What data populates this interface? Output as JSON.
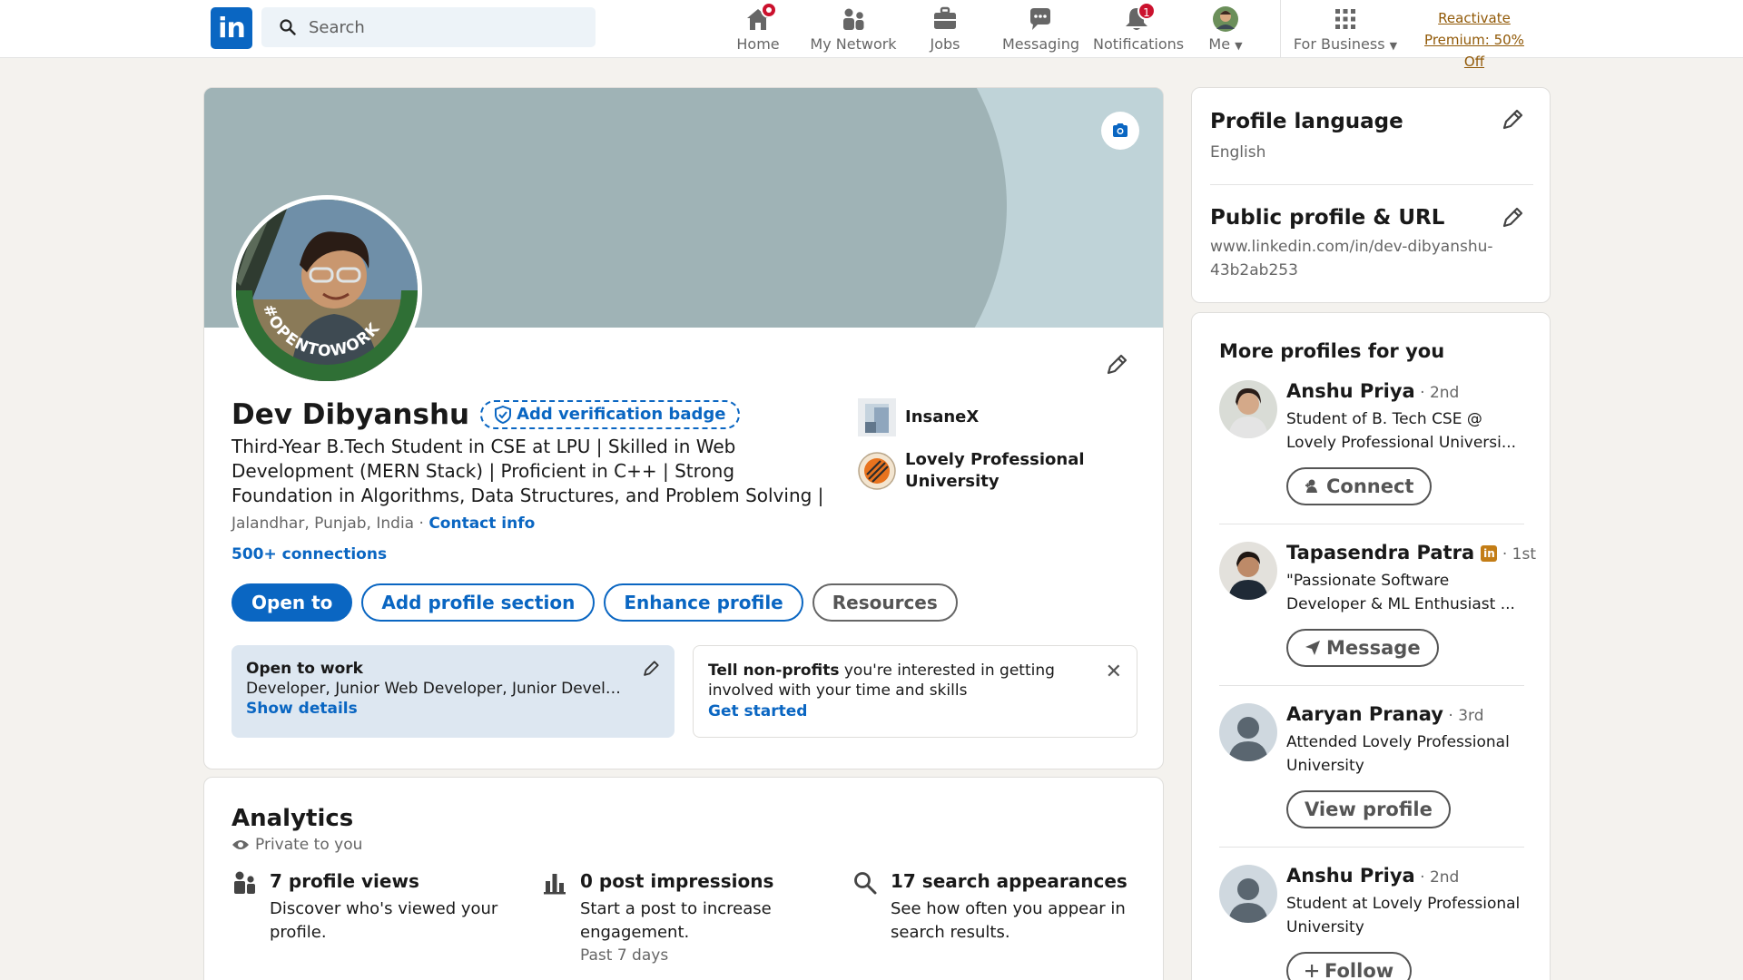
{
  "nav": {
    "logo_text": "in",
    "search_placeholder": "Search",
    "items": [
      {
        "label": "Home",
        "icon": "home-icon",
        "badge": "dot"
      },
      {
        "label": "My Network",
        "icon": "network-icon"
      },
      {
        "label": "Jobs",
        "icon": "briefcase-icon"
      },
      {
        "label": "Messaging",
        "icon": "messaging-icon"
      },
      {
        "label": "Notifications",
        "icon": "bell-icon",
        "badge": "1"
      },
      {
        "label": "Me",
        "icon": "avatar-icon"
      },
      {
        "label": "For Business",
        "icon": "grid-icon"
      }
    ],
    "premium_line1": "Reactivate",
    "premium_line2": "Premium: 50% Off"
  },
  "profile": {
    "name": "Dev Dibyanshu",
    "verification_label": "Add verification badge",
    "avatar_frame_text": "#OPENTOWORK",
    "headline": "Third-Year B.Tech Student in CSE at LPU | Skilled in Web Development (MERN Stack) | Proficient in C++ | Strong Foundation in Algorithms, Data Structures, and Problem Solving |",
    "location": "Jalandhar, Punjab, India",
    "location_sep": " · ",
    "contact_label": "Contact info",
    "connections": "500+ connections",
    "experience": [
      {
        "name": "InsaneX"
      },
      {
        "name": "Lovely Professional University"
      }
    ],
    "actions": {
      "open_to": "Open to",
      "add_section": "Add profile section",
      "enhance": "Enhance profile",
      "resources": "Resources"
    },
    "open_to_work": {
      "title": "Open to work",
      "roles": "Developer, Junior Web Developer, Junior Develo...",
      "link": "Show details"
    },
    "nonprofit": {
      "bold": "Tell non-profits",
      "rest": " you're interested in getting involved with your time and skills",
      "link": "Get started"
    }
  },
  "analytics": {
    "title": "Analytics",
    "privacy": "Private to you",
    "metrics": [
      {
        "title": "7 profile views",
        "desc": "Discover who's viewed your profile.",
        "icon": "people-icon"
      },
      {
        "title": "0 post impressions",
        "desc": "Start a post to increase engagement.",
        "period": "Past 7 days",
        "icon": "bar-chart-icon"
      },
      {
        "title": "17 search appearances",
        "desc": "See how often you appear in search results.",
        "icon": "search-icon"
      }
    ]
  },
  "sidebar": {
    "language_title": "Profile language",
    "language_value": "English",
    "url_title": "Public profile & URL",
    "url_value": "www.linkedin.com/in/dev-dibyanshu-43b2ab253",
    "more_title": "More profiles for you",
    "people": [
      {
        "name": "Anshu Priya",
        "degree": " · 2nd",
        "desc": "Student of B. Tech CSE @ Lovely Professional Universi...",
        "action": "Connect",
        "action_icon": "add-person-icon"
      },
      {
        "name": "Tapasendra Patra",
        "degree": " · 1st",
        "desc": "\"Passionate Software Developer & ML Enthusiast ...",
        "action": "Message",
        "action_icon": "send-icon"
      },
      {
        "name": "Aaryan Pranay",
        "degree": " · 3rd",
        "desc": "Attended Lovely Professional University",
        "action": "View profile"
      },
      {
        "name": "Anshu Priya",
        "degree": " · 2nd",
        "desc": "Student at Lovely Professional University",
        "action": "Follow",
        "action_icon": "plus-icon"
      }
    ]
  },
  "colors": {
    "brand": "#0a66c2",
    "page_bg": "#f4f2ee",
    "badge_red": "#cb112d",
    "premium_gold": "#915907",
    "otw_bg": "#dde7f1"
  }
}
